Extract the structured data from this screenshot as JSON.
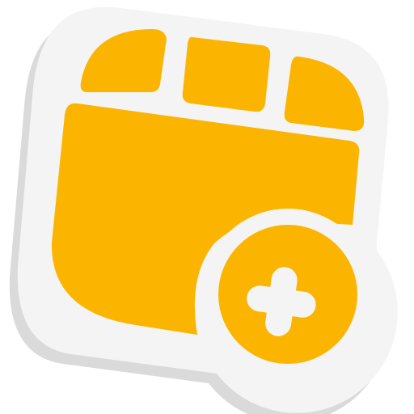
{
  "icon": {
    "name": "add-video-clip-sticker-icon",
    "colors": {
      "accent": "#FBB500",
      "sticker_border": "#F4F4F4",
      "shadow": "#DADADA",
      "plus_symbol": "#F4F4F4"
    }
  }
}
